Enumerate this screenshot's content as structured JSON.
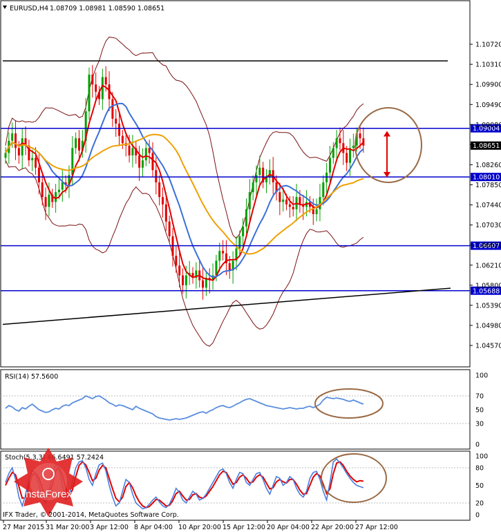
{
  "header": {
    "symbol": "EURUSD,H4",
    "ohlc": "1.08709 1.08981 1.08590 1.08651"
  },
  "colors": {
    "bull": "#00a000",
    "bear": "#e00000",
    "fast_ma": "#e00000",
    "mid_ma": "#3a6fd8",
    "slow_ma": "#f0a000",
    "bands": "#7a1010",
    "level": "#0000cc",
    "trend": "#000000",
    "annot": "#9a6a45",
    "rsi": "#5a8ede",
    "stoch_main": "#4a7ee0",
    "stoch_signal": "#e00000"
  },
  "chart_data": [
    {
      "type": "candlestick",
      "title": "EURUSD,H4",
      "ylim": [
        1.0457,
        1.1113
      ],
      "price_ticks": [
        "1.10720",
        "1.10310",
        "1.09900",
        "1.09490",
        "1.09080",
        "1.08670",
        "1.08260",
        "1.07850",
        "1.07440",
        "1.07030",
        "1.06620",
        "1.06210",
        "1.05800",
        "1.05390",
        "1.04980",
        "1.04570"
      ],
      "horizontal_levels": [
        {
          "value": 1.09004,
          "label": "1.09004"
        },
        {
          "value": 1.0801,
          "label": "1.08010"
        },
        {
          "value": 1.06607,
          "label": "1.06607"
        },
        {
          "value": 1.05688,
          "label": "1.05688"
        }
      ],
      "resistance_line": 1.1038,
      "current_price": "1.08651",
      "closes": [
        1.085,
        1.0875,
        1.089,
        1.086,
        1.0845,
        1.088,
        1.0865,
        1.0835,
        1.084,
        1.082,
        1.079,
        1.076,
        1.074,
        1.0765,
        1.075,
        1.077,
        1.0775,
        1.079,
        1.0785,
        1.0805,
        1.086,
        1.088,
        1.0855,
        1.0875,
        1.0935,
        1.101,
        1.099,
        1.0975,
        1.096,
        1.1005,
        1.099,
        1.096,
        1.092,
        1.091,
        1.0885,
        1.087,
        1.0865,
        1.0845,
        1.086,
        1.0845,
        1.082,
        1.0835,
        1.086,
        1.085,
        1.0815,
        1.079,
        1.076,
        1.0745,
        1.071,
        1.068,
        1.064,
        1.062,
        1.06,
        1.058,
        1.06,
        1.0605,
        1.0595,
        1.061,
        1.059,
        1.0575,
        1.0595,
        1.059,
        1.06,
        1.063,
        1.065,
        1.0645,
        1.0625,
        1.061,
        1.063,
        1.0655,
        1.068,
        1.07,
        1.0735,
        1.077,
        1.079,
        1.0805,
        1.082,
        1.079,
        1.08,
        1.0815,
        1.079,
        1.077,
        1.075,
        1.0755,
        1.0745,
        1.074,
        1.0735,
        1.076,
        1.0745,
        1.074,
        1.075,
        1.074,
        1.0725,
        1.0735,
        1.076,
        1.079,
        1.081,
        1.084,
        1.086,
        1.088,
        1.087,
        1.085,
        1.083,
        1.086,
        1.0865,
        1.089,
        1.088,
        1.0865
      ]
    },
    {
      "type": "line",
      "title": "RSI(14) 57.5600",
      "ylim": [
        0,
        100
      ],
      "ticks": [
        "100",
        "70",
        "50",
        "30",
        "0"
      ],
      "values": [
        52,
        56,
        54,
        50,
        48,
        53,
        51,
        55,
        58,
        54,
        50,
        48,
        46,
        47,
        50,
        52,
        51,
        55,
        57,
        56,
        60,
        62,
        64,
        66,
        70,
        68,
        66,
        69,
        70,
        67,
        64,
        60,
        58,
        55,
        57,
        56,
        54,
        52,
        50,
        55,
        52,
        50,
        48,
        46,
        44,
        40,
        38,
        37,
        36,
        35,
        36,
        37,
        36,
        37,
        38,
        40,
        42,
        44,
        46,
        47,
        45,
        48,
        50,
        53,
        55,
        56,
        54,
        53,
        55,
        58,
        60,
        63,
        65,
        66,
        64,
        62,
        60,
        58,
        56,
        55,
        54,
        53,
        52,
        51,
        52,
        53,
        52,
        51,
        52,
        52,
        54,
        55,
        53,
        55,
        58,
        64,
        68,
        67,
        66,
        67,
        66,
        65,
        63,
        62,
        64,
        62,
        60,
        58
      ]
    },
    {
      "type": "line",
      "title": "Stoch(5,3,3) 46.6491 57.2424",
      "ylim": [
        0,
        100
      ],
      "ticks": [
        "100",
        "80",
        "50",
        "20",
        "0"
      ],
      "series": [
        {
          "values": [
            55,
            70,
            80,
            60,
            30,
            15,
            35,
            60,
            75,
            70,
            50,
            30,
            20,
            40,
            70,
            85,
            80,
            50,
            25,
            30,
            55,
            80,
            90,
            92,
            80,
            60,
            50,
            70,
            85,
            88,
            75,
            50,
            30,
            15,
            20,
            40,
            60,
            55,
            35,
            20,
            15,
            10,
            12,
            18,
            25,
            30,
            22,
            15,
            12,
            18,
            30,
            45,
            38,
            25,
            20,
            30,
            40,
            35,
            25,
            28,
            35,
            45,
            55,
            65,
            75,
            78,
            70,
            55,
            45,
            60,
            72,
            70,
            55,
            50,
            60,
            70,
            72,
            60,
            45,
            35,
            50,
            65,
            62,
            50,
            55,
            65,
            60,
            45,
            35,
            30,
            40,
            62,
            72,
            74,
            60,
            40,
            25,
            55,
            90,
            95,
            88,
            80,
            70,
            62,
            55,
            50,
            48,
            46
          ]
        },
        {
          "values": [
            50,
            62,
            72,
            68,
            48,
            28,
            30,
            50,
            68,
            70,
            62,
            45,
            30,
            32,
            52,
            75,
            80,
            68,
            45,
            32,
            42,
            65,
            84,
            90,
            85,
            72,
            58,
            62,
            76,
            84,
            80,
            62,
            44,
            28,
            22,
            30,
            48,
            55,
            46,
            32,
            22,
            15,
            12,
            14,
            20,
            26,
            25,
            20,
            15,
            16,
            24,
            36,
            40,
            32,
            25,
            26,
            34,
            36,
            30,
            28,
            32,
            40,
            48,
            58,
            68,
            74,
            72,
            62,
            52,
            55,
            64,
            68,
            62,
            54,
            56,
            64,
            68,
            64,
            54,
            44,
            46,
            56,
            60,
            56,
            54,
            60,
            60,
            52,
            42,
            35,
            36,
            50,
            64,
            70,
            66,
            52,
            36,
            44,
            70,
            88,
            90,
            84,
            74,
            66,
            60,
            56,
            58,
            57
          ]
        }
      ]
    }
  ],
  "x_labels": [
    "27 Mar 2015",
    "31 Mar 20:00",
    "3 Apr 12:00",
    "8 Apr 04:00",
    "10 Apr 20:00",
    "15 Apr 12:00",
    "20 Apr 04:00",
    "22 Apr 20:00",
    "27 Apr 12:00"
  ],
  "indicators": {
    "rsi_label": "RSI(14) 57.5600",
    "stoch_label": "Stoch(5,3,3) 46.6491 57.2424"
  },
  "footer": {
    "copyright": "IFX Trader, © 2001-2014, MetaQuotes Software Corp.",
    "logo_text": "InstaForex"
  }
}
